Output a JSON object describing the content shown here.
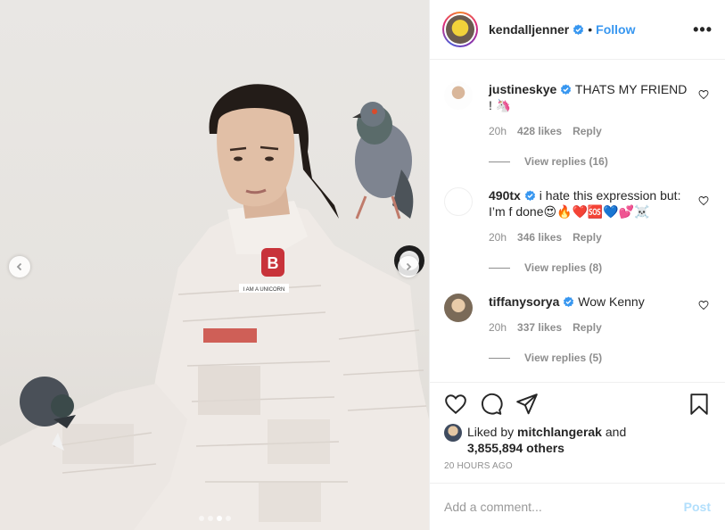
{
  "header": {
    "username": "kendalljenner",
    "separator": "•",
    "follow_label": "Follow",
    "more_label": "•••"
  },
  "comments": [
    {
      "username": "justineskye",
      "text": "THATS MY FRIEND ! 🦄",
      "time": "20h",
      "likes": "428 likes",
      "reply_label": "Reply",
      "view_replies": "View replies (16)"
    },
    {
      "username": "490tx",
      "text": "i hate this expression but: I’m f done😍🔥❤️🆘💙💕☠️",
      "time": "20h",
      "likes": "346 likes",
      "reply_label": "Reply",
      "view_replies": "View replies (8)"
    },
    {
      "username": "tiffanysorya",
      "text": "Wow Kenny",
      "time": "20h",
      "likes": "337 likes",
      "reply_label": "Reply",
      "view_replies": "View replies (5)"
    }
  ],
  "liked_by": {
    "prefix": "Liked by",
    "user": "mitchlangerak",
    "and": "and",
    "others": "3,855,894 others"
  },
  "timestamp": "20 HOURS AGO",
  "comment_box": {
    "placeholder": "Add a comment...",
    "post_label": "Post"
  },
  "carousel": {
    "total": 4,
    "current_index": 2
  },
  "photo_text": {
    "badge_letter": "B",
    "label_text": "I AM A UNICORN"
  },
  "colors": {
    "link_blue": "#3897f0",
    "verified_blue": "#3897f0",
    "text": "#262626",
    "muted": "#8e8e8e"
  },
  "icons": [
    "chevron-left-icon",
    "chevron-right-icon",
    "heart-icon",
    "comment-icon",
    "share-icon",
    "bookmark-icon",
    "verified-icon",
    "more-icon"
  ]
}
